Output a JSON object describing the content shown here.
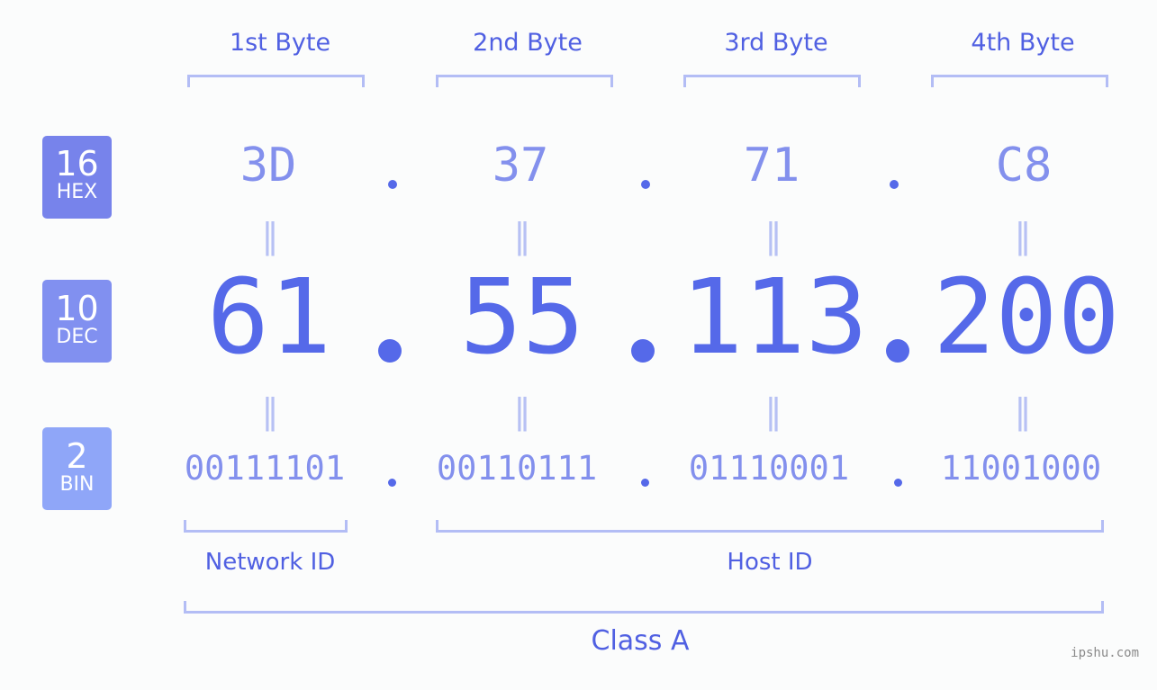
{
  "ip": {
    "bytes": [
      {
        "label": "1st Byte",
        "hex": "3D",
        "dec": "61",
        "bin": "00111101"
      },
      {
        "label": "2nd Byte",
        "hex": "37",
        "dec": "55",
        "bin": "00110111"
      },
      {
        "label": "3rd Byte",
        "hex": "71",
        "dec": "113",
        "bin": "01110001"
      },
      {
        "label": "4th Byte",
        "hex": "C8",
        "dec": "200",
        "bin": "11001000"
      }
    ],
    "separator": ".",
    "equals": "="
  },
  "badges": {
    "hex": {
      "number": "16",
      "label": "HEX",
      "color": "#7783eb"
    },
    "dec": {
      "number": "10",
      "label": "DEC",
      "color": "#8190f0"
    },
    "bin": {
      "number": "2",
      "label": "BIN",
      "color": "#8fa6f8"
    }
  },
  "groups": {
    "network": "Network ID",
    "host": "Host ID",
    "class": "Class A"
  },
  "watermark": "ipshu.com",
  "colors": {
    "accent": "#5569e9",
    "hex_text": "#8390ed",
    "bracket": "#b3bdf5"
  }
}
